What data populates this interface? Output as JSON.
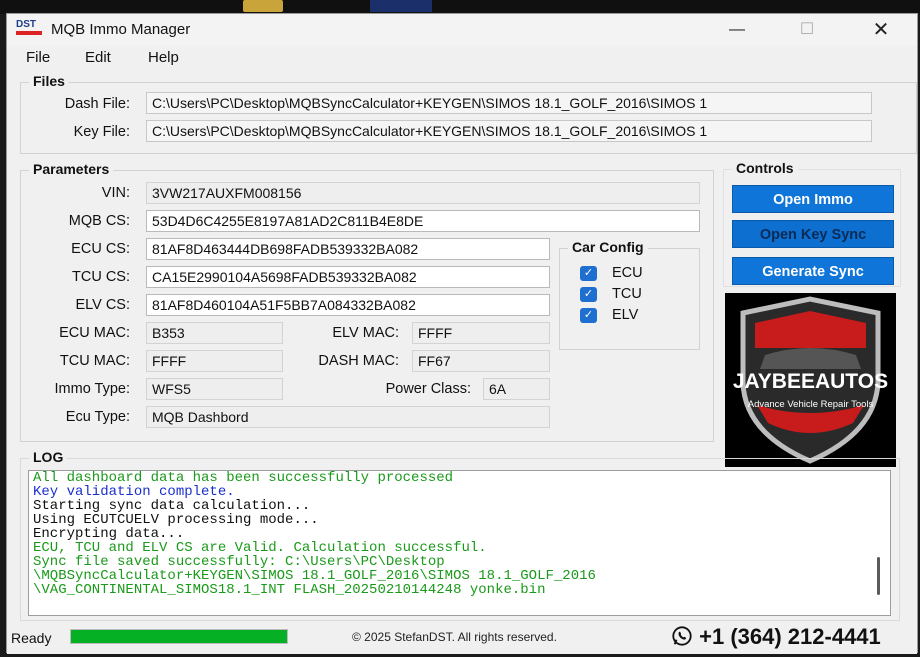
{
  "window": {
    "title": "MQB Immo Manager",
    "logo_text": "DST",
    "controls": {
      "minimize": "—",
      "maximize": "☐",
      "close": "✕"
    }
  },
  "menu": [
    "File",
    "Edit",
    "Help"
  ],
  "files": {
    "group_title": "Files",
    "dash_label": "Dash File:",
    "dash_value": "C:\\Users\\PC\\Desktop\\MQBSyncCalculator+KEYGEN\\SIMOS 18.1_GOLF_2016\\SIMOS 1",
    "key_label": "Key File:",
    "key_value": "C:\\Users\\PC\\Desktop\\MQBSyncCalculator+KEYGEN\\SIMOS 18.1_GOLF_2016\\SIMOS 1"
  },
  "parameters": {
    "group_title": "Parameters",
    "vin_label": "VIN:",
    "vin": "3VW217AUXFM008156",
    "mqb_cs_label": "MQB CS:",
    "mqb_cs": "53D4D6C4255E8197A81AD2C811B4E8DE",
    "ecu_cs_label": "ECU CS:",
    "ecu_cs": "81AF8D463444DB698FADB539332BA082",
    "tcu_cs_label": "TCU CS:",
    "tcu_cs": "CA15E2990104A5698FADB539332BA082",
    "elv_cs_label": "ELV CS:",
    "elv_cs": "81AF8D460104A51F5BB7A084332BA082",
    "ecu_mac_label": "ECU MAC:",
    "ecu_mac": "B353",
    "elv_mac_label": "ELV MAC:",
    "elv_mac": "FFFF",
    "tcu_mac_label": "TCU MAC:",
    "tcu_mac": "FFFF",
    "dash_mac_label": "DASH MAC:",
    "dash_mac": "FF67",
    "immo_type_label": "Immo Type:",
    "immo_type": "WFS5",
    "power_class_label": "Power Class:",
    "power_class": "6A",
    "ecu_type_label": "Ecu Type:",
    "ecu_type": "MQB Dashbord"
  },
  "car_config": {
    "title": "Car Config",
    "items": [
      {
        "label": "ECU",
        "checked": true
      },
      {
        "label": "TCU",
        "checked": true
      },
      {
        "label": "ELV",
        "checked": true
      }
    ]
  },
  "controls": {
    "title": "Controls",
    "open_immo": "Open Immo",
    "open_key_sync": "Open Key Sync",
    "generate_sync": "Generate Sync"
  },
  "promo": {
    "brand": "JAYBEEAUTOS",
    "tagline": "Advance Vehicle Repair Tools"
  },
  "log": {
    "title": "LOG",
    "lines": [
      {
        "text": "All dashboard data has been successfully processed",
        "color": "#1a9a1a"
      },
      {
        "text": "Key validation complete.",
        "color": "#1a2fcc"
      },
      {
        "text": "Starting sync data calculation...",
        "color": "#111111"
      },
      {
        "text": "Using ECUTCUELV processing mode...",
        "color": "#111111"
      },
      {
        "text": "Encrypting data...",
        "color": "#111111"
      },
      {
        "text": "ECU, TCU and ELV CS are Valid. Calculation successful.",
        "color": "#1a9a1a"
      },
      {
        "text": "Sync file saved successfully: C:\\Users\\PC\\Desktop",
        "color": "#1a9a1a"
      },
      {
        "text": "\\MQBSyncCalculator+KEYGEN\\SIMOS 18.1_GOLF_2016\\SIMOS 18.1_GOLF_2016",
        "color": "#1a9a1a"
      },
      {
        "text": "\\VAG_CONTINENTAL_SIMOS18.1_INT FLASH_20250210144248 yonke.bin",
        "color": "#1a9a1a"
      }
    ]
  },
  "status": {
    "ready": "Ready",
    "progress_percent": 100,
    "copyright": "© 2025 StefanDST. All rights reserved.",
    "phone": "+1 (364) 212-4441"
  },
  "colors": {
    "accent_button": "#1075d8",
    "progress": "#06b025",
    "checkbox": "#1f6fd0"
  }
}
